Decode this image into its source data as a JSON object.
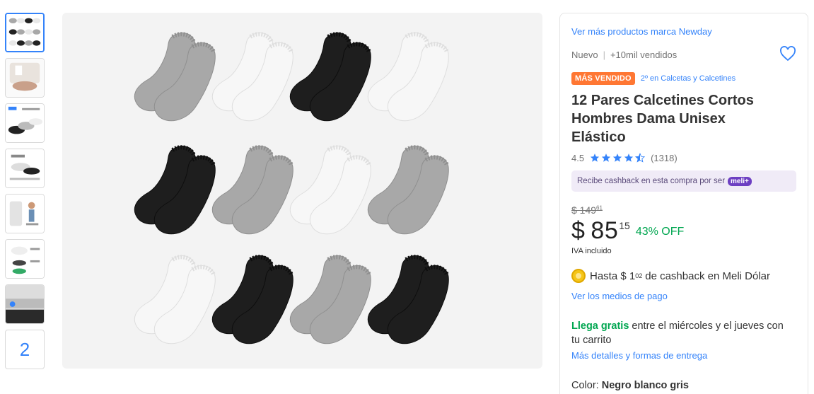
{
  "thumbnails": {
    "more_count": "2"
  },
  "buybox": {
    "brand_link": "Ver más productos marca Newday",
    "condition": "Nuevo",
    "sold": "+10mil vendidos",
    "badge": "MÁS VENDIDO",
    "badge_rank": "2º en Calcetas y Calcetines",
    "title": "12 Pares Calcetines Cortos Hombres Dama Unisex Elástico",
    "rating_value": "4.5",
    "rating_count": "(1318)",
    "stars_filled": 4.5,
    "cashback_text": "Recibe cashback en esta compra por ser",
    "meli_plus": "meli+",
    "old_price_main": "$ 149",
    "old_price_cents": "61",
    "price_symbol": "$",
    "price_main": "85",
    "price_cents": "15",
    "discount": "43% OFF",
    "iva": "IVA incluido",
    "cashback_prefix": "Hasta $ 1",
    "cashback_cents": "02",
    "cashback_suffix": "de cashback en Meli Dólar",
    "payment_link": "Ver los medios de pago",
    "shipping_green": "Llega gratis",
    "shipping_rest": "entre el miércoles y el jueves con tu carrito",
    "shipping_link": "Más detalles y formas de entrega",
    "color_label": "Color:",
    "color_value": "Negro blanco gris"
  },
  "colors": {
    "link": "#3483fa",
    "green": "#00a650",
    "badge": "#ff7733",
    "sock_gray": "#a8a8a8",
    "sock_white": "#f7f7f7",
    "sock_black": "#1e1e1e"
  }
}
